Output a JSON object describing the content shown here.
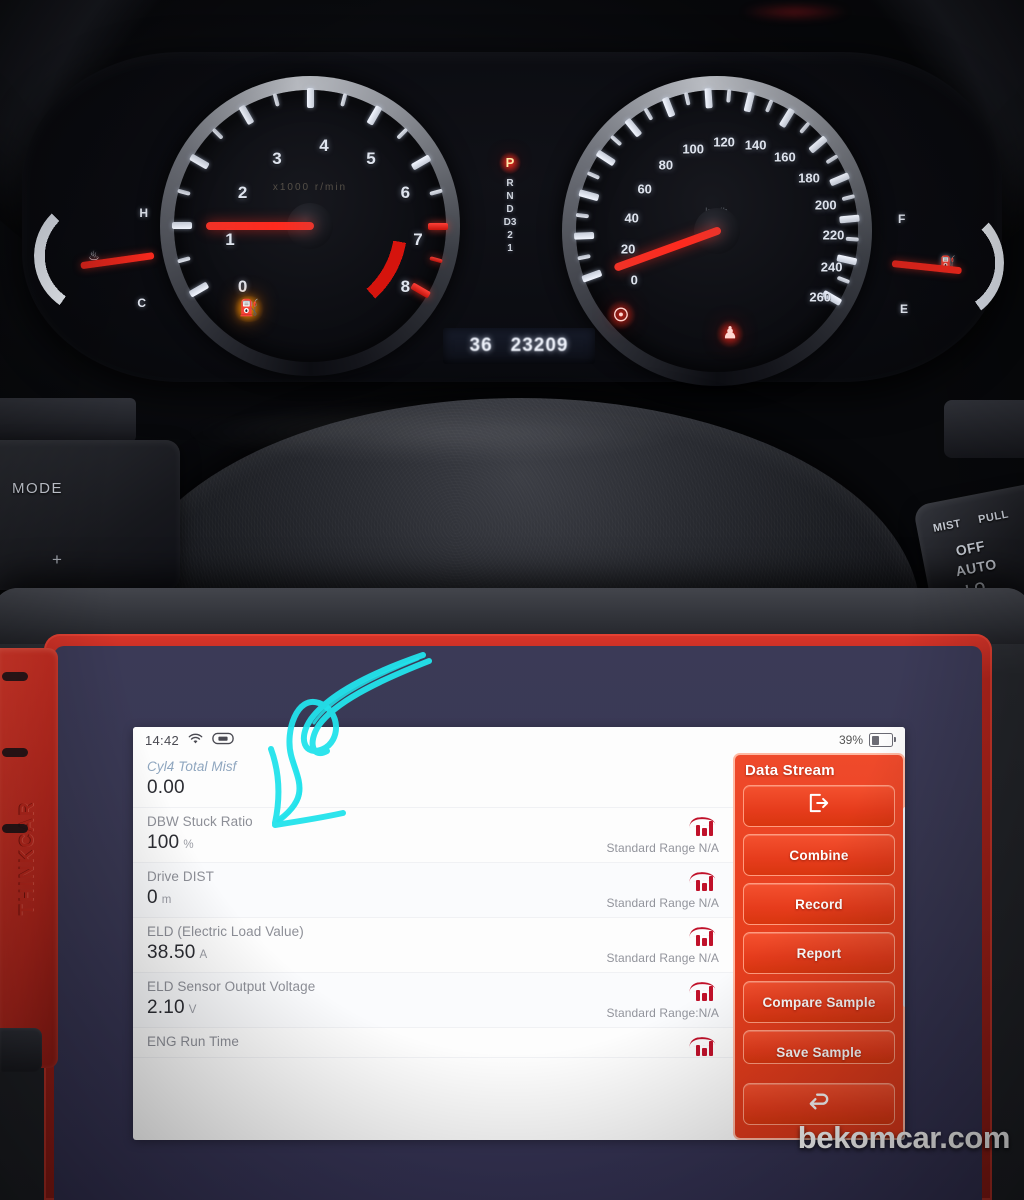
{
  "watermark": "bekomcar.com",
  "device": {
    "brand": "THINKCAR"
  },
  "status_bar": {
    "clock": "14:42",
    "wifi_icon": "wifi-icon",
    "vci_icon": "vci-connection-icon",
    "battery_percent": "39%",
    "battery_icon": "battery-icon"
  },
  "panel": {
    "title": "Data Stream",
    "buttons": [
      {
        "label": "↪",
        "name": "exit-button",
        "icon": "exit-icon"
      },
      {
        "label": "Combine",
        "name": "combine-button",
        "icon": ""
      },
      {
        "label": "Record",
        "name": "record-button",
        "icon": ""
      },
      {
        "label": "Report",
        "name": "report-button",
        "icon": ""
      },
      {
        "label": "Compare Sample",
        "name": "compare-sample-button",
        "icon": ""
      },
      {
        "label": "Save Sample",
        "name": "save-sample-button",
        "icon": ""
      }
    ],
    "back_label": "↶",
    "back_icon": "back-arrow-icon"
  },
  "data_stream": {
    "range_label_a": "Standard Range N/A",
    "range_label_b": "Standard Range:N/A",
    "chart_icon": "bar-chart-icon",
    "rows": [
      {
        "name": "Cyl4 Total Misf",
        "value": "0.00",
        "unit": "",
        "range": ""
      },
      {
        "name": "DBW Stuck Ratio",
        "value": "100",
        "unit": "%",
        "range": "Standard Range N/A"
      },
      {
        "name": "Drive DIST",
        "value": "0",
        "unit": "m",
        "range": "Standard Range N/A"
      },
      {
        "name": "ELD (Electric Load Value)",
        "value": "38.50",
        "unit": "A",
        "range": "Standard Range N/A"
      },
      {
        "name": "ELD Sensor Output Voltage",
        "value": "2.10",
        "unit": "V",
        "range": "Standard Range:N/A"
      },
      {
        "name": "ENG Run Time",
        "value": "",
        "unit": "",
        "range": ""
      }
    ]
  },
  "instrument_cluster": {
    "tachometer": {
      "label": "tachometer",
      "unit": "x1000 r/min",
      "ticks": [
        "0",
        "1",
        "2",
        "3",
        "4",
        "5",
        "6",
        "7",
        "8"
      ],
      "needle_value": "1",
      "redline_start": "7"
    },
    "speedometer": {
      "label": "speedometer",
      "unit": "km/h",
      "ticks": [
        "0",
        "20",
        "40",
        "60",
        "80",
        "100",
        "120",
        "140",
        "160",
        "180",
        "200",
        "220",
        "240",
        "260"
      ],
      "needle_value": "0"
    },
    "temp_gauge": {
      "high": "H",
      "low": "C",
      "icon": "coolant-temp-icon"
    },
    "fuel_gauge": {
      "high": "F",
      "low": "E",
      "icon": "fuel-pump-icon"
    },
    "gear_selector": {
      "active": "P",
      "positions": [
        "R",
        "N",
        "D",
        "D3",
        "2",
        "1"
      ]
    },
    "odometer": {
      "trip": "36",
      "total": "23209"
    },
    "telltales": [
      {
        "name": "oil-pressure-warning-icon",
        "glyph": "⛽",
        "color": "#ffd24a"
      },
      {
        "name": "charging-system-warning-icon",
        "glyph": "⊙",
        "color": "#ff4b38"
      },
      {
        "name": "seatbelt-warning-icon",
        "glyph": "♟",
        "color": "#ff4b38"
      }
    ]
  },
  "cabin_controls": {
    "steering_mode_label": "MODE",
    "steering_plus_label": "+",
    "wiper_stalk": [
      "MIST",
      "PULL",
      "OFF",
      "AUTO",
      "LO"
    ]
  },
  "annotation": {
    "type": "hand-drawn-arrow",
    "color": "#22E3EC"
  }
}
